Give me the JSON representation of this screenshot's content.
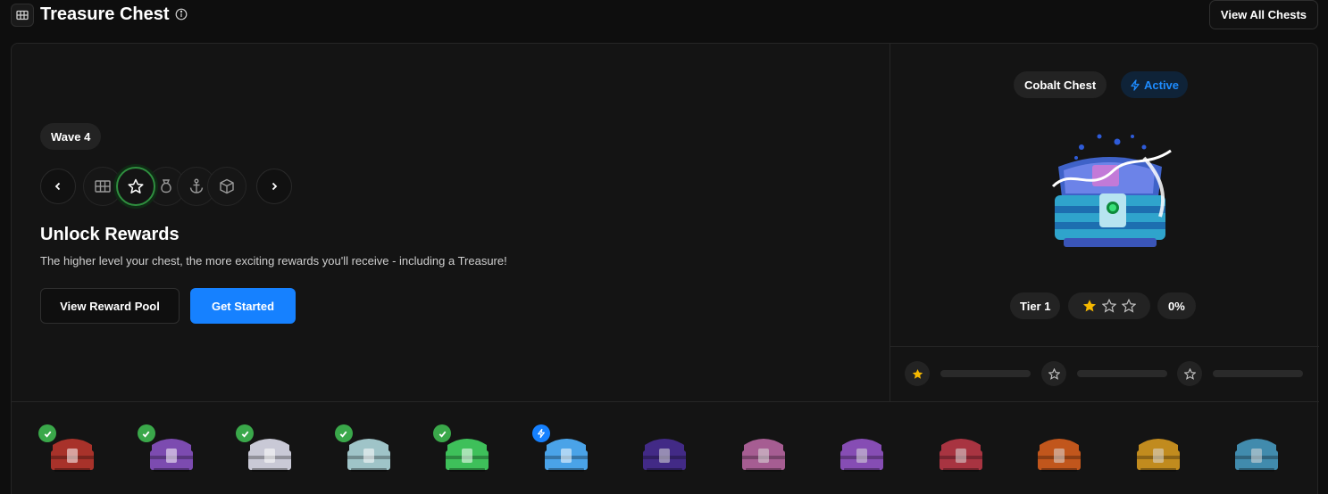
{
  "header": {
    "title": "Treasure Chest",
    "view_all_label": "View All Chests"
  },
  "hero": {
    "wave_label": "Wave 4",
    "wave_icons": [
      "map-icon",
      "star-icon",
      "money-bag-icon",
      "anchor-icon",
      "box-icon"
    ],
    "active_wave_icon_index": 1,
    "title": "Unlock Rewards",
    "description": "The higher level your chest, the more exciting rewards you'll receive - including a Treasure!",
    "view_reward_pool_label": "View Reward Pool",
    "get_started_label": "Get Started"
  },
  "chest": {
    "name": "Cobalt Chest",
    "status": "Active",
    "tier_label": "Tier 1",
    "stars_filled": 1,
    "stars_total": 3,
    "progress_label": "0%",
    "progress_fraction": 0
  },
  "colors": {
    "accent": "#1681ff",
    "success": "#3aa84a",
    "star": "#f5b800",
    "background": "#0e0e0e",
    "panel": "#141414"
  },
  "chest_strip": [
    {
      "name": "red-chest",
      "status": "completed",
      "color": "#a8322a"
    },
    {
      "name": "purple-orange-chest",
      "status": "completed",
      "color": "#7c4bb0"
    },
    {
      "name": "white-orange-chest",
      "status": "completed",
      "color": "#c9c9d6"
    },
    {
      "name": "silver-green-chest",
      "status": "completed",
      "color": "#9fc4c8"
    },
    {
      "name": "green-chest",
      "status": "completed",
      "color": "#3ec05a"
    },
    {
      "name": "cobalt-chest",
      "status": "active",
      "color": "#4aa3e8"
    },
    {
      "name": "dark-purple-chest",
      "status": "locked",
      "color": "#4b2f9a"
    },
    {
      "name": "pink-chest",
      "status": "locked",
      "color": "#c06aa8"
    },
    {
      "name": "violet-gold-chest",
      "status": "locked",
      "color": "#9a57d0"
    },
    {
      "name": "crimson-chest",
      "status": "locked",
      "color": "#c23a4a"
    },
    {
      "name": "orange-gold-chest",
      "status": "locked",
      "color": "#e0621e"
    },
    {
      "name": "golden-chest",
      "status": "locked",
      "color": "#e0a020"
    },
    {
      "name": "crystal-chest",
      "status": "locked",
      "color": "#4aa0c8"
    }
  ]
}
